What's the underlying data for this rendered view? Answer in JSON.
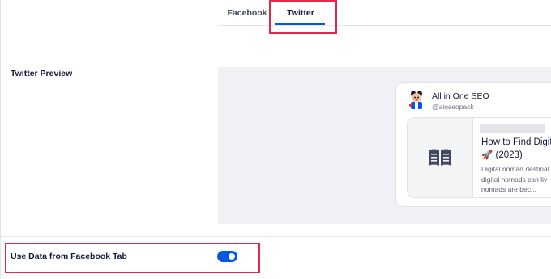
{
  "tabs": [
    {
      "label": "Facebook",
      "active": false
    },
    {
      "label": "Twitter",
      "active": true
    }
  ],
  "twitter_preview": {
    "section_label": "Twitter Preview",
    "account_name": "All in One SEO",
    "account_handle": "@aioseopack",
    "card_title_line1": "How to Find Digita",
    "card_title_line2": "🚀 (2023)",
    "card_desc_line1": "Digital nomad destinat",
    "card_desc_line2": "digital nomads can liv",
    "card_desc_line3": "nomads are bec...",
    "thumb_icon": "book-open-icon",
    "avatar_icon": "aioseo-mascot-icon"
  },
  "settings": {
    "use_facebook_data_label": "Use Data from Facebook Tab",
    "use_facebook_data_enabled": true
  },
  "colors": {
    "accent": "#005ae0",
    "highlight": "#df2a4a",
    "preview_bg": "#f0f1f4"
  }
}
